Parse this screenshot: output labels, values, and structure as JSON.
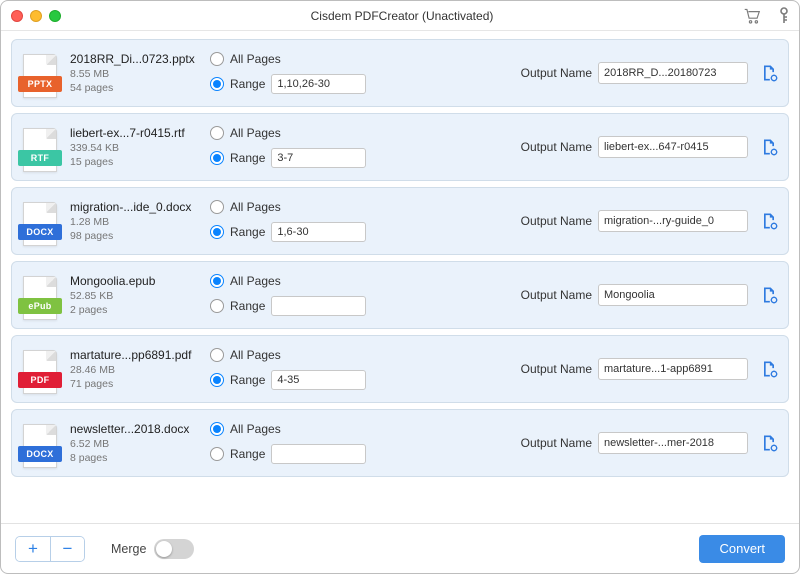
{
  "window": {
    "title": "Cisdem PDFCreator (Unactivated)"
  },
  "labels": {
    "all_pages": "All Pages",
    "range": "Range",
    "output_name": "Output Name",
    "merge": "Merge",
    "convert": "Convert",
    "add": "+",
    "remove": "−"
  },
  "files": [
    {
      "type": "pptx",
      "type_label": "PPTX",
      "name": "2018RR_Di...0723.pptx",
      "size": "8.55 MB",
      "pages": "54 pages",
      "range_selected": true,
      "range_value": "1,10,26-30",
      "output_name": "2018RR_D...20180723"
    },
    {
      "type": "rtf",
      "type_label": "RTF",
      "name": "liebert-ex...7-r0415.rtf",
      "size": "339.54 KB",
      "pages": "15 pages",
      "range_selected": true,
      "range_value": "3-7",
      "output_name": "liebert-ex...647-r0415"
    },
    {
      "type": "docx",
      "type_label": "DOCX",
      "name": "migration-...ide_0.docx",
      "size": "1.28 MB",
      "pages": "98 pages",
      "range_selected": true,
      "range_value": "1,6-30",
      "output_name": "migration-...ry-guide_0"
    },
    {
      "type": "epub",
      "type_label": "ePub",
      "name": "Mongoolia.epub",
      "size": "52.85 KB",
      "pages": "2 pages",
      "range_selected": false,
      "range_value": "",
      "output_name": "Mongoolia"
    },
    {
      "type": "pdf",
      "type_label": "PDF",
      "name": "martature...pp6891.pdf",
      "size": "28.46 MB",
      "pages": "71 pages",
      "range_selected": true,
      "range_value": "4-35",
      "output_name": "martature...1-app6891"
    },
    {
      "type": "docx",
      "type_label": "DOCX",
      "name": "newsletter...2018.docx",
      "size": "6.52 MB",
      "pages": "8 pages",
      "range_selected": false,
      "range_value": "",
      "output_name": "newsletter-...mer-2018"
    }
  ]
}
